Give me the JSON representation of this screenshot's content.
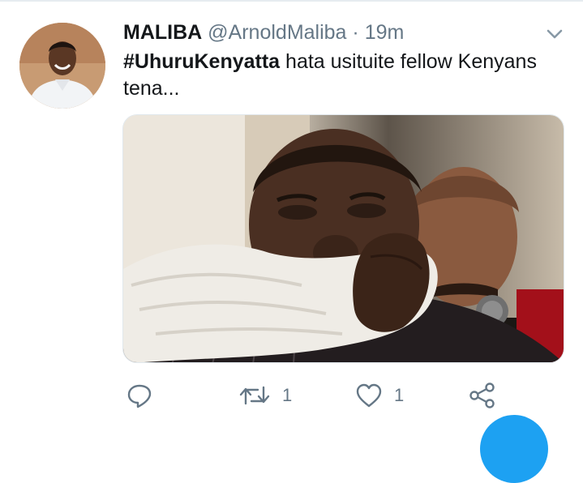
{
  "tweet": {
    "author_name": "MALIBA",
    "handle": "@ArnoldMaliba",
    "separator": "·",
    "time": "19m",
    "hashtag": "#UhuruKenyatta",
    "text": "hata usituite fellow Kenyans tena..."
  },
  "actions": {
    "reply": {
      "icon": "reply-icon",
      "count": ""
    },
    "retweet": {
      "icon": "retweet-icon",
      "count": "1"
    },
    "like": {
      "icon": "heart-icon",
      "count": "1"
    },
    "share": {
      "icon": "share-icon",
      "count": ""
    }
  },
  "colors": {
    "text": "#14171a",
    "muted": "#657786",
    "accent": "#1da1f2",
    "divider": "#e6ecf0"
  }
}
